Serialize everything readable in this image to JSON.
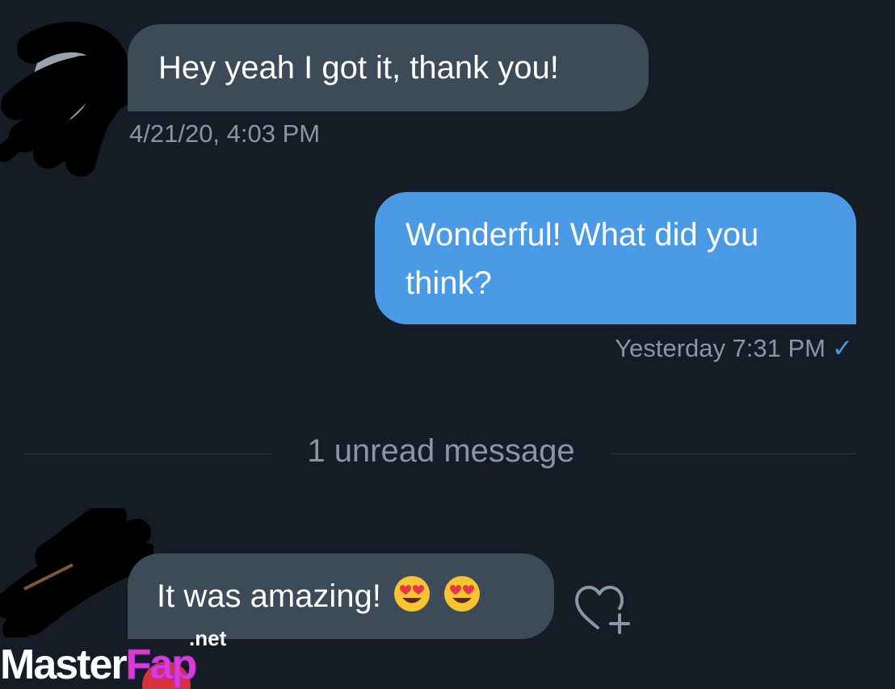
{
  "messages": [
    {
      "direction": "incoming",
      "text": "Hey yeah I got it, thank you!",
      "timestamp": "4/21/20, 4:03 PM"
    },
    {
      "direction": "outgoing",
      "text_line1": "Wonderful! What did you",
      "text_line2": "think?",
      "timestamp": "Yesterday 7:31 PM",
      "read_mark": "✓"
    },
    {
      "direction": "incoming",
      "text": "It was amazing!",
      "emoji": [
        "smiling-face-with-heart-eyes",
        "smiling-face-with-heart-eyes"
      ]
    }
  ],
  "unread_divider": {
    "label": "1 unread message"
  },
  "reaction": {
    "icon": "heart-plus-icon"
  },
  "watermark": {
    "main": "Master",
    "accent": "Fap",
    "suffix": ".net"
  },
  "colors": {
    "background": "#151c25",
    "incoming_bubble": "#3d4b58",
    "outgoing_bubble": "#4a9ae5",
    "meta_text": "#8897a6"
  }
}
